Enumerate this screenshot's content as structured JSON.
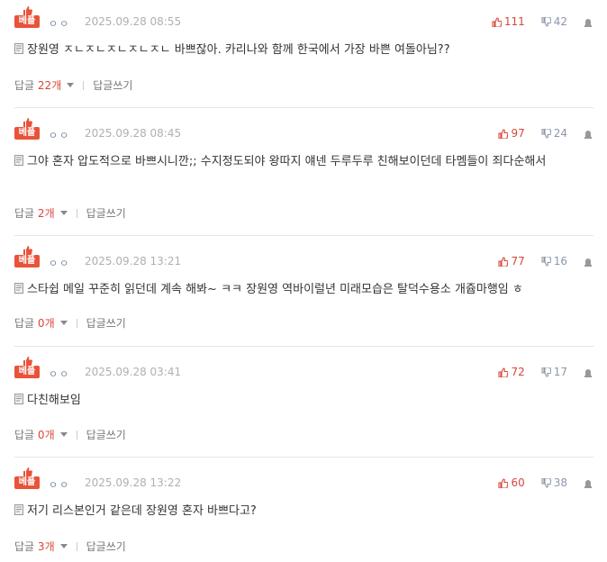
{
  "badge_label": "베플",
  "nickname": "ㅇㅇ",
  "reply_label": "답글",
  "count_suffix": "개",
  "write_reply": "답글쓰기",
  "comments": [
    {
      "date": "2025.09.28 08:55",
      "up": "111",
      "down": "42",
      "text": "장원영 ㅈㄴㅈㄴㅈㄴㅈㄴㅈㄴ 바쁘잖아. 카리나와 함께 한국에서 가장 바쁜 여돌아님??",
      "replies": "22"
    },
    {
      "date": "2025.09.28 08:45",
      "up": "97",
      "down": "24",
      "text": "그야 혼자 압도적으로 바쁘시니깐;; 수지정도되야 왕따지 얘넨 두루두루 친해보이던데 타멤들이 죄다순해서",
      "replies": "2"
    },
    {
      "date": "2025.09.28 13:21",
      "up": "77",
      "down": "16",
      "text": "스타쉽 메일 꾸준히 읽던데 계속 해봐~ ㅋㅋ 장원영 역바이럴년 미래모습은 탈덕수용소 개쥽마행임 ㅎ",
      "replies": "0"
    },
    {
      "date": "2025.09.28 03:41",
      "up": "72",
      "down": "17",
      "text": "다친해보임",
      "replies": "0"
    },
    {
      "date": "2025.09.28 13:22",
      "up": "60",
      "down": "38",
      "text": "저기 리스본인거 같은데 장원영 혼자 바쁘다고?",
      "replies": "3"
    }
  ],
  "colors": {
    "accent": "#e8533a",
    "up": "#d9463a",
    "down": "#8b97a8"
  }
}
